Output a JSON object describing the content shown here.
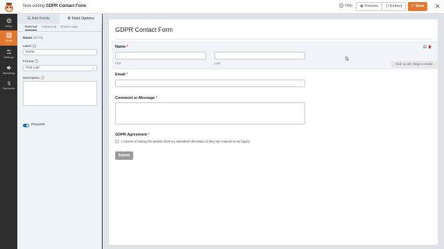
{
  "header": {
    "editing_prefix": "Now editing",
    "form_name": "GDPR Contact Form",
    "help_label": "Help",
    "preview_label": "Preview",
    "embed_label": "Embed",
    "save_label": "Save",
    "close_symbol": "✕"
  },
  "leftnav": {
    "items": [
      {
        "label": "Setup",
        "icon": "gear-icon"
      },
      {
        "label": "Fields",
        "icon": "fields-icon",
        "active": true
      },
      {
        "label": "Settings",
        "icon": "sliders-icon"
      },
      {
        "label": "Marketing",
        "icon": "megaphone-icon"
      },
      {
        "label": "Payments",
        "icon": "dollar-icon"
      }
    ]
  },
  "panel": {
    "tabs": [
      "Add Fields",
      "Field Options"
    ],
    "subtabs": [
      "General",
      "Advanced",
      "Smart Logic"
    ],
    "field_title": "Name",
    "field_id": "(ID #0)",
    "label_caption": "Label",
    "label_value": "Name",
    "format_caption": "Format",
    "format_value": "First Last",
    "description_caption": "Description",
    "required_caption": "Required"
  },
  "form": {
    "title": "GDPR Contact Form",
    "name_label": "Name",
    "first_caption": "First",
    "last_caption": "Last",
    "email_label": "Email",
    "comment_label": "Comment or Message",
    "gdpr_label": "GDPR Agreement",
    "consent_text": "I consent to having this website store my submitted information so they can respond to my inquiry.",
    "submit_label": "Submit",
    "required_mark": "*",
    "tooltip": "Click to edit. Drag to reorder."
  },
  "colors": {
    "accent": "#e27730",
    "nav_bg": "#2d2d2d",
    "panel_bg": "#eef3f8",
    "stage_bg": "#dfe3e8"
  }
}
